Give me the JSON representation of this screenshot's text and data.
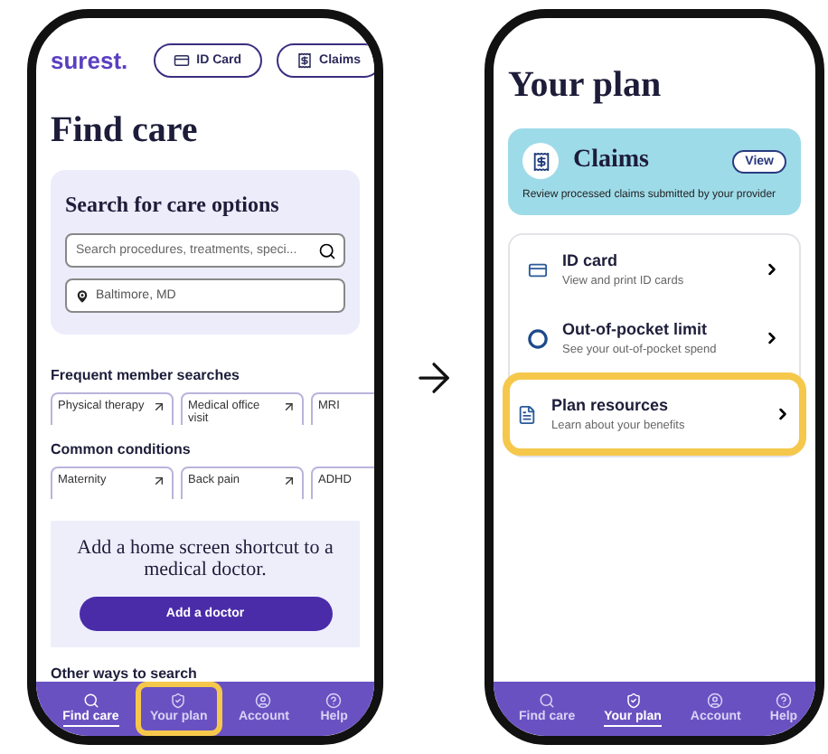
{
  "find_care_screen": {
    "logo": "surest.",
    "header_buttons": [
      {
        "kind": "card",
        "label": "ID Card"
      },
      {
        "kind": "receipt",
        "label": "Claims"
      }
    ],
    "title": "Find care",
    "search_card": {
      "heading": "Search for care options",
      "search": {
        "placeholder": "Search procedures, treatments, speci..."
      },
      "location": {
        "value": "Baltimore, MD"
      }
    },
    "sections": [
      {
        "heading": "Frequent member searches",
        "chips": [
          {
            "label": "Physical therapy"
          },
          {
            "label": "Medical office visit"
          },
          {
            "label": "MRI"
          }
        ]
      },
      {
        "heading": "Common conditions",
        "chips": [
          {
            "label": "Maternity"
          },
          {
            "label": "Back pain"
          },
          {
            "label": "ADHD"
          }
        ]
      }
    ],
    "promo": {
      "text": "Add a home screen shortcut to a medical doctor.",
      "button": "Add a doctor"
    },
    "footer_heading": "Other ways to search",
    "nav": [
      {
        "kind": "search",
        "label": "Find care",
        "selected": true,
        "highlighted": false
      },
      {
        "kind": "shield",
        "label": "Your plan",
        "selected": false,
        "highlighted": true
      },
      {
        "kind": "user",
        "label": "Account",
        "selected": false,
        "highlighted": false
      },
      {
        "kind": "help",
        "label": "Help",
        "selected": false,
        "highlighted": false
      }
    ]
  },
  "your_plan_screen": {
    "title": "Your plan",
    "claims_card": {
      "title": "Claims",
      "button": "View",
      "text": "Review processed claims submitted by your provider"
    },
    "items": [
      {
        "kind": "card",
        "title": "ID card",
        "subtitle": "View and print ID cards",
        "highlighted": false
      },
      {
        "kind": "ring",
        "title": "Out-of-pocket limit",
        "subtitle": "See your out-of-pocket spend",
        "highlighted": false
      },
      {
        "kind": "doc",
        "title": "Plan resources",
        "subtitle": "Learn about your benefits",
        "highlighted": true
      }
    ],
    "nav": [
      {
        "kind": "search",
        "label": "Find care",
        "selected": false,
        "highlighted": false
      },
      {
        "kind": "shield",
        "label": "Your plan",
        "selected": true,
        "highlighted": false
      },
      {
        "kind": "user",
        "label": "Account",
        "selected": false,
        "highlighted": false
      },
      {
        "kind": "help",
        "label": "Help",
        "selected": false,
        "highlighted": false
      }
    ]
  }
}
